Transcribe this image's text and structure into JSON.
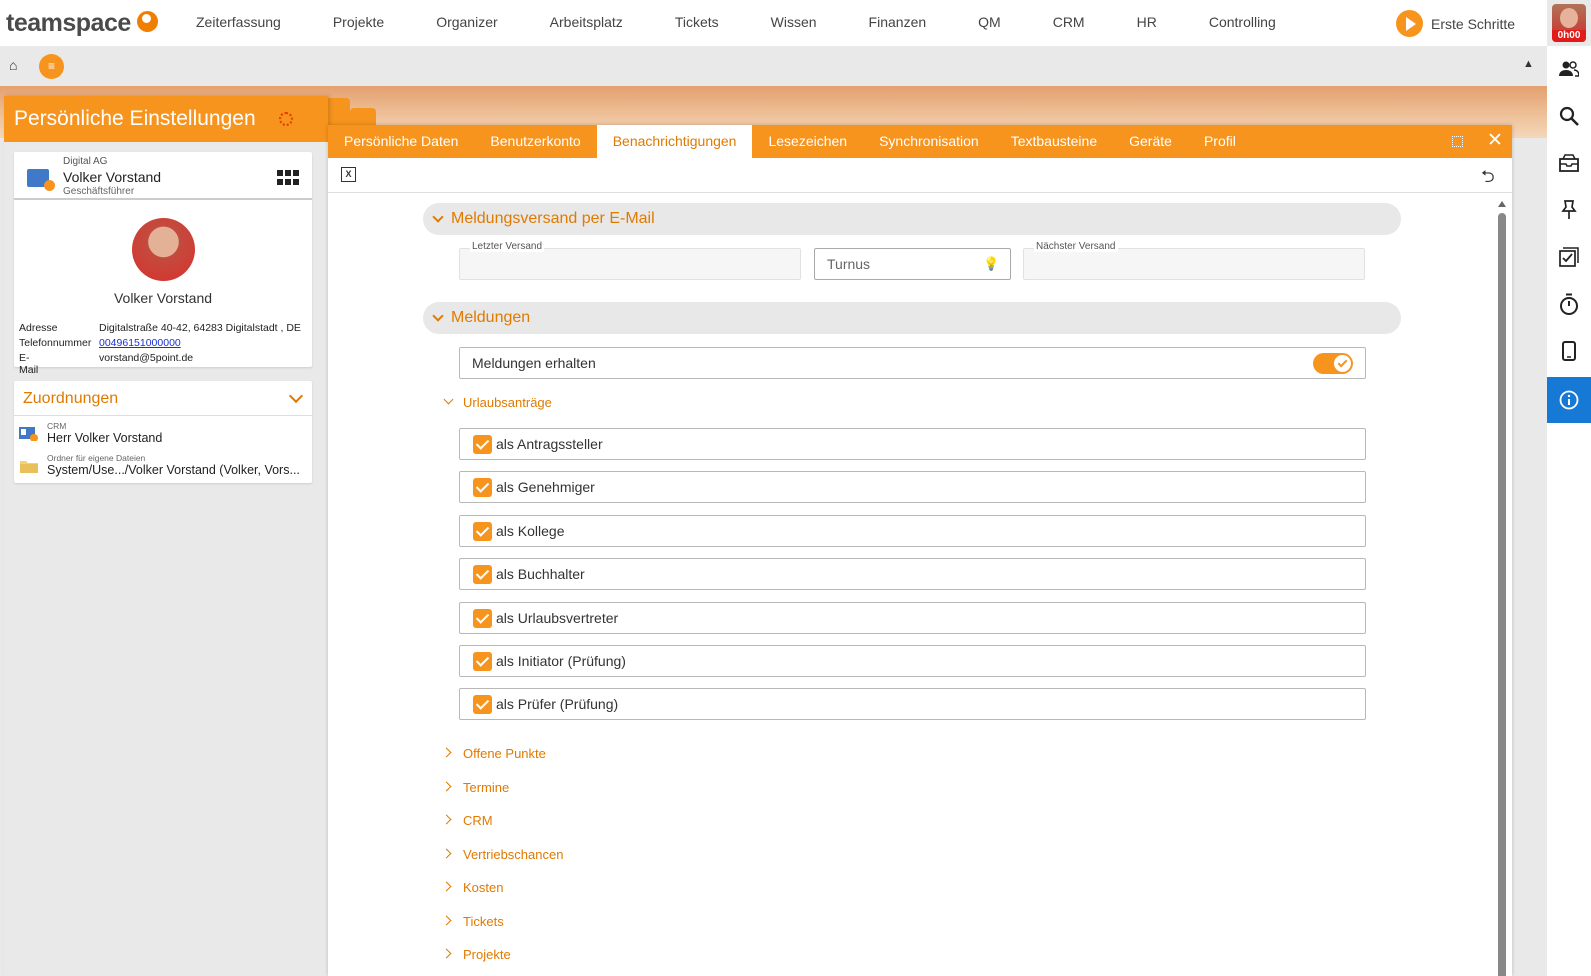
{
  "app": {
    "logo_text": "teamspace"
  },
  "topnav": {
    "items": [
      "Zeiterfassung",
      "Projekte",
      "Organizer",
      "Arbeitsplatz",
      "Tickets",
      "Wissen",
      "Finanzen",
      "QM",
      "CRM",
      "HR",
      "Controlling"
    ],
    "erste_schritte": "Erste Schritte",
    "avatar_badge": "0h00"
  },
  "subbar": {
    "home_icon": "home-icon",
    "menu_icon": "menu-icon"
  },
  "rail": {
    "icons": [
      "users-icon",
      "search-icon",
      "inbox-icon",
      "pin-icon",
      "tasks-icon",
      "stopwatch-icon",
      "mobile-icon",
      "info-icon"
    ],
    "active": "info-icon"
  },
  "left": {
    "title": "Persönliche Einstellungen",
    "profile": {
      "company": "Digital AG",
      "name": "Volker Vorstand",
      "role": "Geschäftsführer",
      "photo_name": "Volker Vorstand",
      "fields": [
        {
          "key": "Adresse",
          "value": "Digitalstraße 40-42, 64283 Digitalstadt , DE"
        },
        {
          "key": "Telefonnummer",
          "value": "00496151000000"
        },
        {
          "key": "E-Mail",
          "value": "vorstand@5point.de"
        }
      ]
    },
    "assignments": {
      "title": "Zuordnungen",
      "items": [
        {
          "small": "CRM",
          "main": "Herr Volker Vorstand"
        },
        {
          "small": "Ordner für eigene Dateien",
          "main": "System/Use.../Volker Vorstand (Volker, Vors..."
        }
      ]
    }
  },
  "dialog": {
    "tabs": [
      "Persönliche Daten",
      "Benutzerkonto",
      "Benachrichtigungen",
      "Lesezeichen",
      "Synchronisation",
      "Textbausteine",
      "Geräte",
      "Profil"
    ],
    "active_tab": "Benachrichtigungen",
    "close": "✕",
    "email_section": {
      "title": "Meldungsversand per E-Mail",
      "letzter_label": "Letzter Versand",
      "letzter_value": "",
      "turnus_placeholder": "Turnus",
      "naechster_label": "Nächster Versand",
      "naechster_value": ""
    },
    "meldungen_section": {
      "title": "Meldungen",
      "receive_label": "Meldungen erhalten",
      "receive_on": true,
      "urlaub_title": "Urlaubsanträge",
      "checkboxes": [
        {
          "label": "als Antragssteller",
          "checked": true
        },
        {
          "label": "als Genehmiger",
          "checked": true
        },
        {
          "label": "als Kollege",
          "checked": true
        },
        {
          "label": "als Buchhalter",
          "checked": true
        },
        {
          "label": "als Urlaubsvertreter",
          "checked": true
        },
        {
          "label": "als Initiator (Prüfung)",
          "checked": true
        },
        {
          "label": "als Prüfer (Prüfung)",
          "checked": true
        }
      ],
      "collapsed_groups": [
        "Offene Punkte",
        "Termine",
        "CRM",
        "Vertriebschancen",
        "Kosten",
        "Tickets",
        "Projekte"
      ]
    }
  }
}
